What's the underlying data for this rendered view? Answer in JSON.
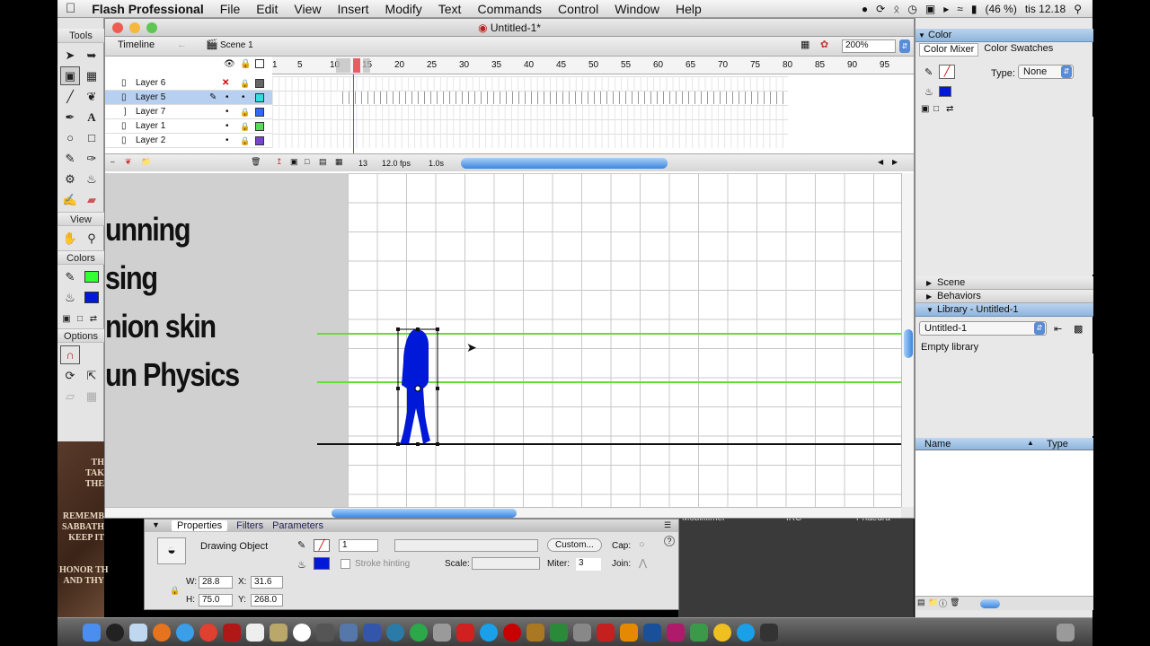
{
  "menubar": {
    "app": "Flash Professional",
    "items": [
      "File",
      "Edit",
      "View",
      "Insert",
      "Modify",
      "Text",
      "Commands",
      "Control",
      "Window",
      "Help"
    ],
    "battery": "(46 %)",
    "clock": "tis 12.18"
  },
  "window": {
    "title": "Untitled-1*"
  },
  "timeline": {
    "tab": "Timeline",
    "scene": "Scene 1",
    "zoom": "200%",
    "frame_numbers": [
      "1",
      "5",
      "10",
      "15",
      "20",
      "25",
      "30",
      "35",
      "40",
      "45",
      "50",
      "55",
      "60",
      "65",
      "70",
      "75",
      "80",
      "85",
      "90",
      "95"
    ],
    "layers": [
      "Layer 6",
      "Layer 5",
      "Layer 7",
      "Layer 1",
      "Layer 2"
    ],
    "current_frame": "13",
    "fps": "12.0 fps",
    "time": "1.0s"
  },
  "stage_text": [
    "unning",
    "sing",
    "nion skin",
    "un Physics"
  ],
  "tools": {
    "title": "Tools",
    "view": "View",
    "colors": "Colors",
    "options": "Options"
  },
  "properties": {
    "tabs": [
      "Properties",
      "Filters",
      "Parameters"
    ],
    "object": "Drawing Object",
    "stroke_size": "1",
    "custom_button": "Custom...",
    "cap": "Cap:",
    "stroke_hinting": "Stroke hinting",
    "scale": "Scale:",
    "miter": "Miter:",
    "miter_value": "3",
    "join": "Join:",
    "w_label": "W:",
    "w": "28.8",
    "x_label": "X:",
    "x": "31.6",
    "h_label": "H:",
    "h": "75.0",
    "y_label": "Y:",
    "y": "268.0"
  },
  "color_panel": {
    "title": "Color",
    "tabs": [
      "Color Mixer",
      "Color Swatches"
    ],
    "type_label": "Type:",
    "type_value": "None"
  },
  "scene_panel": "Scene",
  "behaviors_panel": "Behaviors",
  "library": {
    "title": "Library - Untitled-1",
    "doc": "Untitled-1",
    "status": "Empty library",
    "col_name": "Name",
    "col_type": "Type"
  },
  "desktop_text": "TH\nTAK\nTHE\n\n\nREMEMB\nSABBATH\nKEEP IT\n\n\nHONOR TH\nAND THY",
  "desktop_right_text": [
    "Mobilfilmer",
    "IRC",
    "Phaedra"
  ],
  "colors": {
    "accent_blue": "#0018d8",
    "onion_green": "#66dd33",
    "playhead": "#e03030"
  }
}
